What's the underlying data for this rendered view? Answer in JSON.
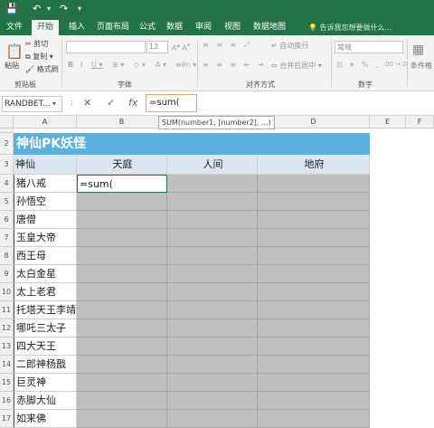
{
  "titlebar": {
    "save_icon": "save-icon",
    "undo_icon": "undo-icon",
    "redo_icon": "redo-icon"
  },
  "menu": {
    "tabs": [
      "文件",
      "开始",
      "插入",
      "页面布局",
      "公式",
      "数据",
      "审阅",
      "视图",
      "数据地图"
    ],
    "tell_me": "告诉我您想要做什么..."
  },
  "ribbon": {
    "clipboard": {
      "paste": "粘贴",
      "cut": "剪切",
      "copy": "复制 ▾",
      "format_painter": "格式刷",
      "label": "剪贴板"
    },
    "font": {
      "size": "12",
      "label": "字体"
    },
    "alignment": {
      "wrap": "自动换行",
      "merge": "合并后居中 ▾",
      "label": "对齐方式"
    },
    "number": {
      "format": "常规",
      "label": "数字"
    },
    "styles": {
      "conditional": "条件格"
    }
  },
  "formula_bar": {
    "name_box": "RANDBET...",
    "cancel_icon": "✕",
    "enter_icon": "✓",
    "fx": "fx",
    "formula": "=sum(",
    "tooltip": "SUM(number1, [number2], ...)"
  },
  "sheet": {
    "columns": [
      "A",
      "B",
      "C",
      "D",
      "E",
      "F"
    ],
    "row_numbers": [
      "1",
      "2",
      "3",
      "4",
      "5",
      "6",
      "7",
      "8",
      "9",
      "10",
      "11",
      "12",
      "13",
      "14",
      "15",
      "16",
      "17"
    ],
    "title": "神仙PK妖怪",
    "headers": [
      "神仙",
      "天庭",
      "人间",
      "地府"
    ],
    "editing_cell": "=sum(",
    "names": [
      "猪八戒",
      "孙悟空",
      "唐僧",
      "玉皇大帝",
      "西王母",
      "太白金星",
      "太上老君",
      "托塔天王李靖",
      "哪吒三太子",
      "四大天王",
      "二郎神杨戬",
      "巨灵神",
      "赤脚大仙",
      "如来佛"
    ]
  },
  "colors": {
    "excel_green": "#217346",
    "title_blue": "#5bb0e0",
    "header_blue": "#dce6f1",
    "grey_cells": "#bfbfbf"
  }
}
